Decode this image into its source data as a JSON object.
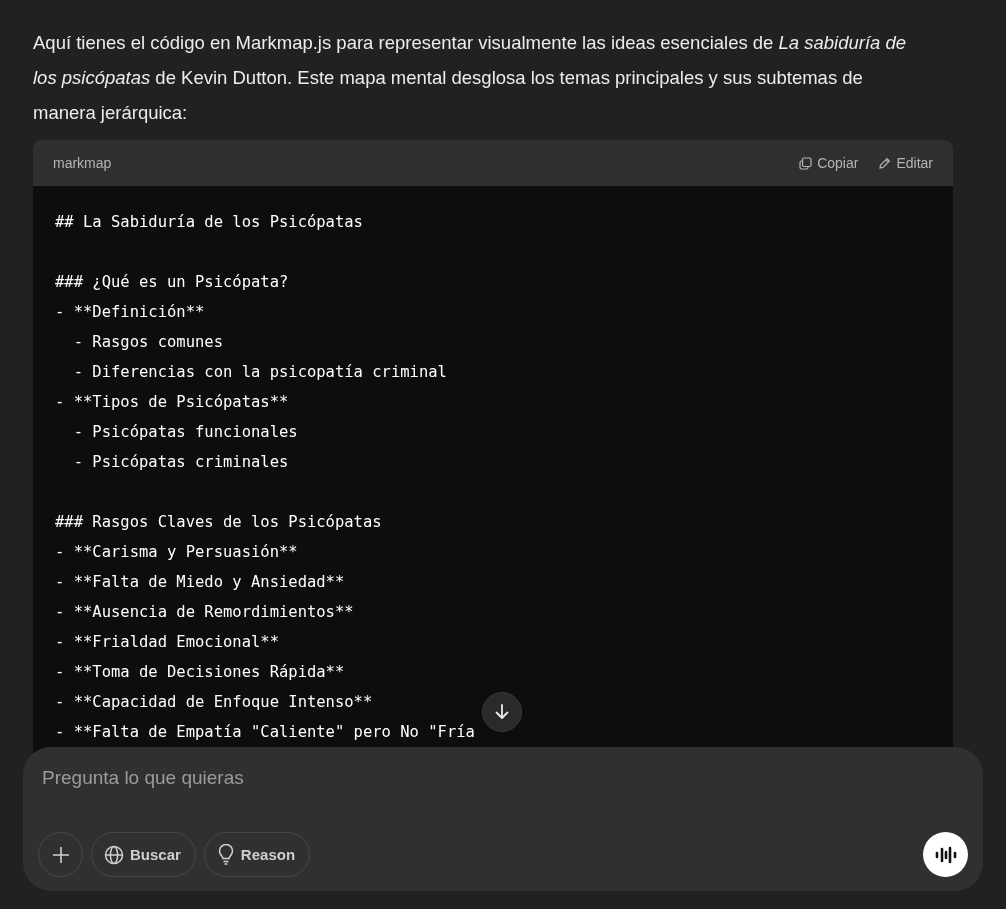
{
  "message": {
    "text": "Aquí tienes el código en Markmap.js para representar visualmente las ideas esenciales de *La sabiduría de los psicópatas* de Kevin Dutton. Este mapa mental desglosa los temas principales y sus subtemas de manera jerárquica:"
  },
  "code_block": {
    "language": "markmap",
    "actions": [
      {
        "kind": "copy",
        "label": "Copiar"
      },
      {
        "kind": "edit",
        "label": "Editar"
      }
    ],
    "sections": [
      {
        "lines": [
          "## La Sabiduría de los Psicópatas"
        ]
      },
      {
        "lines": [
          "### ¿Qué es un Psicópata?",
          "- **Definición**",
          "  - Rasgos comunes",
          "  - Diferencias con la psicopatía criminal",
          "- **Tipos de Psicópatas**",
          "  - Psicópatas funcionales",
          "  - Psicópatas criminales"
        ]
      },
      {
        "lines": [
          "### Rasgos Claves de los Psicópatas",
          "- **Carisma y Persuasión**",
          "- **Falta de Miedo y Ansiedad**",
          "- **Ausencia de Remordimientos**",
          "- **Frialdad Emocional**",
          "- **Toma de Decisiones Rápida**",
          "- **Capacidad de Enfoque Intenso**",
          "- **Falta de Empatía \"Caliente\" pero No \"Fría"
        ]
      }
    ]
  },
  "composer": {
    "placeholder": "Pregunta lo que quieras",
    "tools": [
      {
        "kind": "plus"
      },
      {
        "kind": "globe",
        "label": "Buscar"
      },
      {
        "kind": "bulb",
        "label": "Reason"
      }
    ]
  }
}
